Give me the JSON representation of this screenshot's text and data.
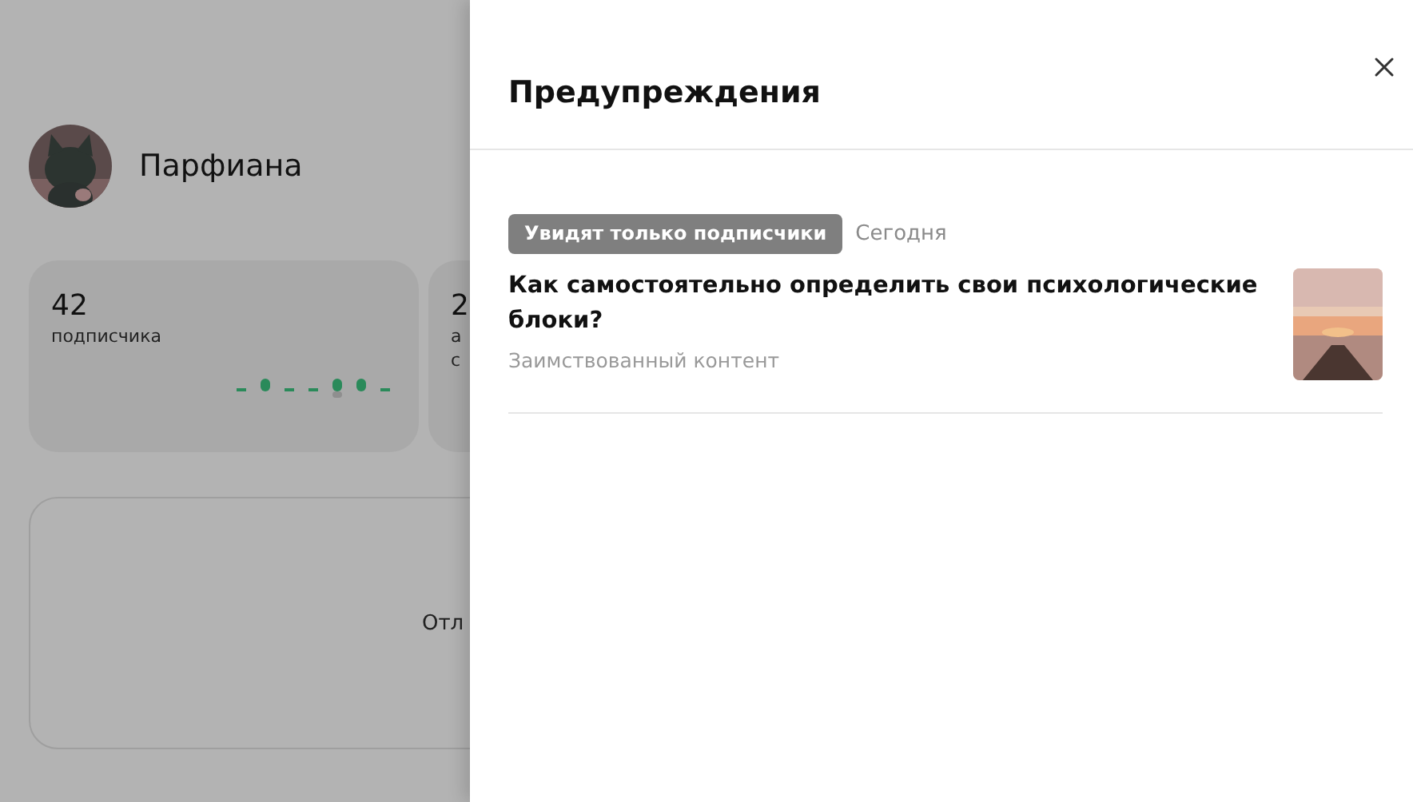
{
  "profile": {
    "name": "Парфиана"
  },
  "stats": [
    {
      "value": "42",
      "label_lines": [
        "подписчика"
      ]
    },
    {
      "value": "2",
      "label_lines": [
        "а",
        "с"
      ]
    }
  ],
  "notice_card": {
    "text": "Отл"
  },
  "warnings_panel": {
    "title": "Предупреждения",
    "items": [
      {
        "badge": "Увидят только подписчики",
        "date": "Сегодня",
        "title": "Как самостоятельно определить свои психологические блоки?",
        "source": "Заимствованный контент"
      }
    ]
  }
}
